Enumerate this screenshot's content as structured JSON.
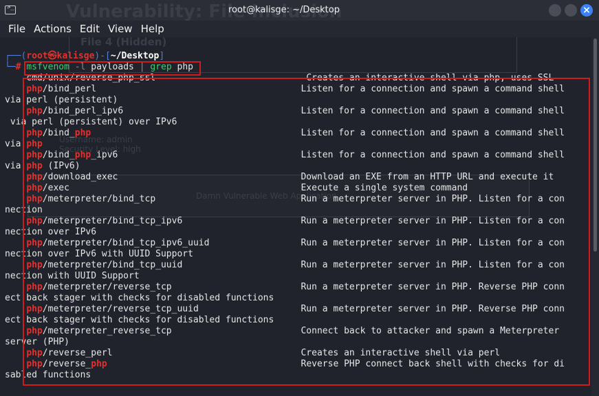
{
  "window": {
    "title": "root@kalisge: ~/Desktop",
    "background_title": "Vulnerability: File Inclusion",
    "close_glyph": "×"
  },
  "menu": [
    "File",
    "Actions",
    "Edit",
    "View",
    "Help"
  ],
  "ghost": {
    "file_heading": "File 4 (Hidden)",
    "username": "Username: admin",
    "security": "Security Level: high",
    "app": "Damn Vulnerable Web Application"
  },
  "prompt": {
    "open": "┌──(",
    "user": "root㉿kalisge",
    "mid": ")-[",
    "path": "~/Desktop",
    "close": "]",
    "hash_prefix": "└─",
    "hash": "#",
    "cmd1": "msfvenom",
    "flag": "-l",
    "arg": "payloads",
    "pipe": "|",
    "cmd2": "grep",
    "pattern": "php"
  },
  "first_line": "    cmd/unix/reverse_php_ssl                            Creates an interactive shell via php, uses SSL",
  "lines": [
    [
      [
        "    ",
        ""
      ],
      [
        "php",
        "r"
      ],
      [
        "/bind_perl                                      Listen for a connection and spawn a command shell",
        ""
      ]
    ],
    [
      [
        "via perl (persistent)",
        ""
      ]
    ],
    [
      [
        "    ",
        ""
      ],
      [
        "php",
        "r"
      ],
      [
        "/bind_perl_ipv6                                 Listen for a connection and spawn a command shell",
        ""
      ]
    ],
    [
      [
        " via perl (persistent) over IPv6",
        ""
      ]
    ],
    [
      [
        "    ",
        ""
      ],
      [
        "php",
        "r"
      ],
      [
        "/bind_",
        ""
      ],
      [
        "php",
        "r"
      ],
      [
        "                                       Listen for a connection and spawn a command shell",
        ""
      ]
    ],
    [
      [
        "via ",
        ""
      ],
      [
        "php",
        "r"
      ]
    ],
    [
      [
        "    ",
        ""
      ],
      [
        "php",
        "r"
      ],
      [
        "/bind_",
        ""
      ],
      [
        "php",
        "r"
      ],
      [
        "_ipv6                                  Listen for a connection and spawn a command shell",
        ""
      ]
    ],
    [
      [
        "via ",
        ""
      ],
      [
        "php",
        "r"
      ],
      [
        " (IPv6)",
        ""
      ]
    ],
    [
      [
        "    ",
        ""
      ],
      [
        "php",
        "r"
      ],
      [
        "/download_exec                                  Download an EXE from an HTTP URL and execute it",
        ""
      ]
    ],
    [
      [
        "    ",
        ""
      ],
      [
        "php",
        "r"
      ],
      [
        "/exec                                           Execute a single system command",
        ""
      ]
    ],
    [
      [
        "    ",
        ""
      ],
      [
        "php",
        "r"
      ],
      [
        "/meterpreter/bind_tcp                           Run a meterpreter server in PHP. Listen for a con",
        ""
      ]
    ],
    [
      [
        "nection",
        ""
      ]
    ],
    [
      [
        "    ",
        ""
      ],
      [
        "php",
        "r"
      ],
      [
        "/meterpreter/bind_tcp_ipv6                      Run a meterpreter server in PHP. Listen for a con",
        ""
      ]
    ],
    [
      [
        "nection over IPv6",
        ""
      ]
    ],
    [
      [
        "    ",
        ""
      ],
      [
        "php",
        "r"
      ],
      [
        "/meterpreter/bind_tcp_ipv6_uuid                 Run a meterpreter server in PHP. Listen for a con",
        ""
      ]
    ],
    [
      [
        "nection over IPv6 with UUID Support",
        ""
      ]
    ],
    [
      [
        "    ",
        ""
      ],
      [
        "php",
        "r"
      ],
      [
        "/meterpreter/bind_tcp_uuid                      Run a meterpreter server in PHP. Listen for a con",
        ""
      ]
    ],
    [
      [
        "nection with UUID Support",
        ""
      ]
    ],
    [
      [
        "    ",
        ""
      ],
      [
        "php",
        "r"
      ],
      [
        "/meterpreter/reverse_tcp                        Run a meterpreter server in PHP. Reverse PHP conn",
        ""
      ]
    ],
    [
      [
        "ect back stager with checks for disabled functions",
        ""
      ]
    ],
    [
      [
        "    ",
        ""
      ],
      [
        "php",
        "r"
      ],
      [
        "/meterpreter/reverse_tcp_uuid                   Run a meterpreter server in PHP. Reverse PHP conn",
        ""
      ]
    ],
    [
      [
        "ect back stager with checks for disabled functions",
        ""
      ]
    ],
    [
      [
        "    ",
        ""
      ],
      [
        "php",
        "r"
      ],
      [
        "/meterpreter_reverse_tcp                        Connect back to attacker and spawn a Meterpreter",
        ""
      ]
    ],
    [
      [
        "server (PHP)",
        ""
      ]
    ],
    [
      [
        "    ",
        ""
      ],
      [
        "php",
        "r"
      ],
      [
        "/reverse_perl                                   Creates an interactive shell via perl",
        ""
      ]
    ],
    [
      [
        "    ",
        ""
      ],
      [
        "php",
        "r"
      ],
      [
        "/reverse_",
        ""
      ],
      [
        "php",
        "r"
      ],
      [
        "                                    Reverse PHP connect back shell with checks for di",
        ""
      ]
    ],
    [
      [
        "sabled functions",
        ""
      ]
    ]
  ]
}
